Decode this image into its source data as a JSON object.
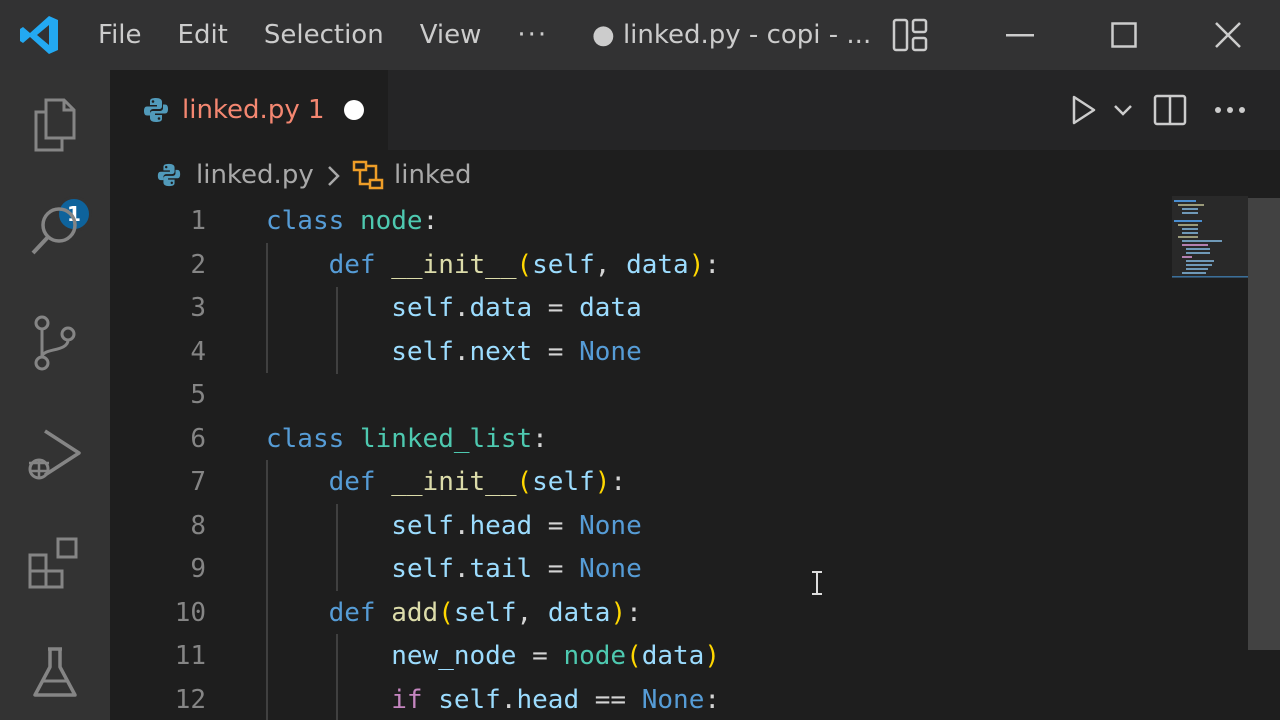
{
  "titlebar": {
    "menu": [
      "File",
      "Edit",
      "Selection",
      "View"
    ],
    "more": "···",
    "window_title": "● linked.py - copi - ...",
    "colors": {
      "vscode_blue": "#23a9f2"
    }
  },
  "activitybar": {
    "items": [
      "explorer-icon",
      "search-icon",
      "source-control-icon",
      "run-debug-icon",
      "extensions-icon",
      "testing-icon"
    ],
    "explorer_badge": "1"
  },
  "tab": {
    "label": "linked.py 1",
    "icon": "python-icon"
  },
  "breadcrumb": {
    "file": "linked.py",
    "separator": ">",
    "symbol": "linked"
  },
  "editor": {
    "line_numbers": [
      "1",
      "2",
      "3",
      "4",
      "5",
      "6",
      "7",
      "8",
      "9",
      "10",
      "11",
      "12"
    ],
    "lines": [
      "class node:",
      "    def __init__(self, data):",
      "        self.data = data",
      "        self.next = None",
      "",
      "class linked_list:",
      "    def __init__(self):",
      "        self.head = None",
      "        self.tail = None",
      "    def add(self, data):",
      "        new_node = node(data)",
      "        if self.head == None:"
    ]
  }
}
